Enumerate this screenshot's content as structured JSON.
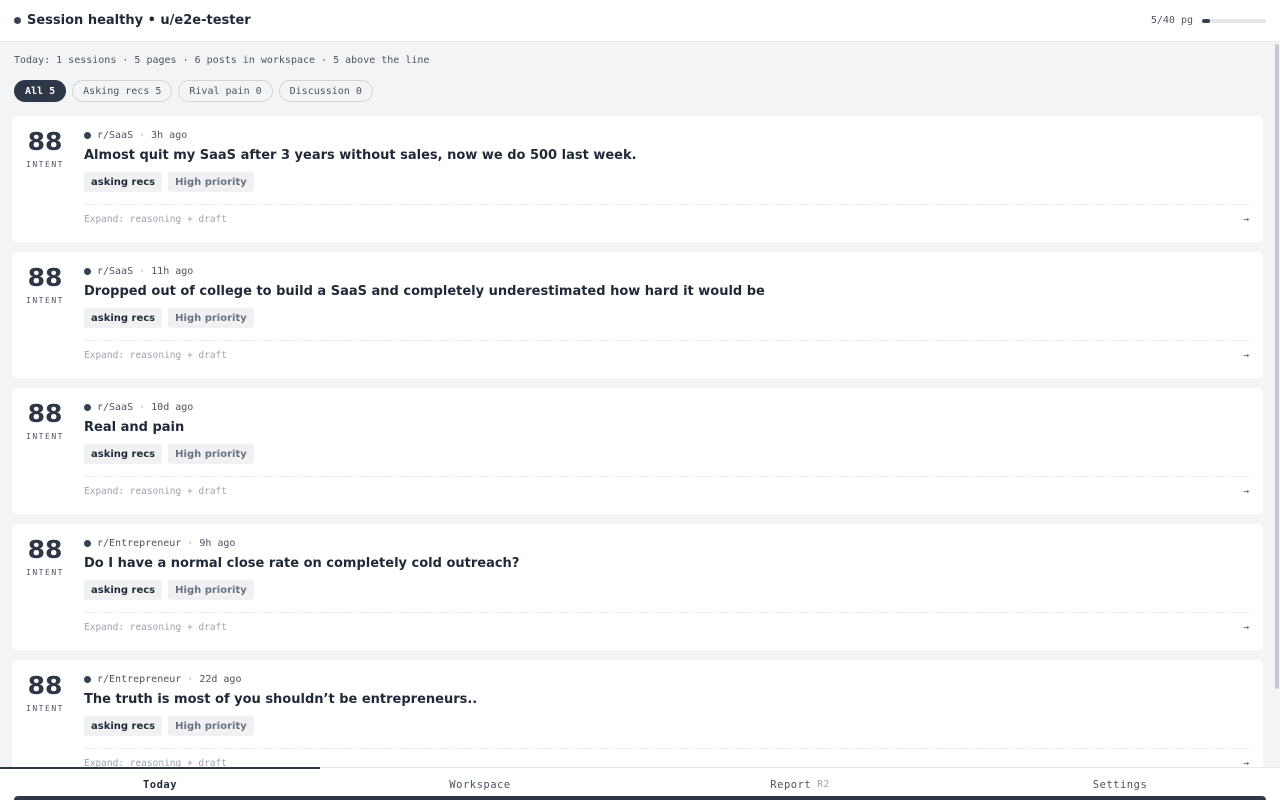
{
  "header": {
    "session_title": "Session healthy • u/e2e-tester",
    "quota_label": "5/40 pg",
    "quota_used": 5,
    "quota_total": 40
  },
  "summary": "Today: 1 sessions · 5 pages · 6 posts in workspace · 5 above the line",
  "filters": [
    {
      "label": "All 5",
      "active": true
    },
    {
      "label": "Asking recs 5",
      "active": false
    },
    {
      "label": "Rival pain 0",
      "active": false
    },
    {
      "label": "Discussion 0",
      "active": false
    }
  ],
  "score_label": "INTENT",
  "expand_label": "Expand: reasoning + draft",
  "posts": [
    {
      "score": "88",
      "subreddit": "r/SaaS",
      "age": "3h ago",
      "title": "Almost quit my SaaS after 3 years without sales, now we do 500 last week.",
      "tags": [
        "asking recs",
        "High priority"
      ]
    },
    {
      "score": "88",
      "subreddit": "r/SaaS",
      "age": "11h ago",
      "title": "Dropped out of college to build a SaaS and completely underestimated how hard it would be",
      "tags": [
        "asking recs",
        "High priority"
      ]
    },
    {
      "score": "88",
      "subreddit": "r/SaaS",
      "age": "10d ago",
      "title": "Real and pain",
      "tags": [
        "asking recs",
        "High priority"
      ]
    },
    {
      "score": "88",
      "subreddit": "r/Entrepreneur",
      "age": "9h ago",
      "title": "Do I have a normal close rate on completely cold outreach?",
      "tags": [
        "asking recs",
        "High priority"
      ]
    },
    {
      "score": "88",
      "subreddit": "r/Entrepreneur",
      "age": "22d ago",
      "title": "The truth is most of you shouldn’t be entrepreneurs..",
      "tags": [
        "asking recs",
        "High priority"
      ]
    }
  ],
  "tabs": [
    {
      "label": "Today",
      "badge": "",
      "active": true
    },
    {
      "label": "Workspace",
      "badge": "",
      "active": false
    },
    {
      "label": "Report",
      "badge": "R2",
      "active": false
    },
    {
      "label": "Settings",
      "badge": "",
      "active": false
    }
  ]
}
